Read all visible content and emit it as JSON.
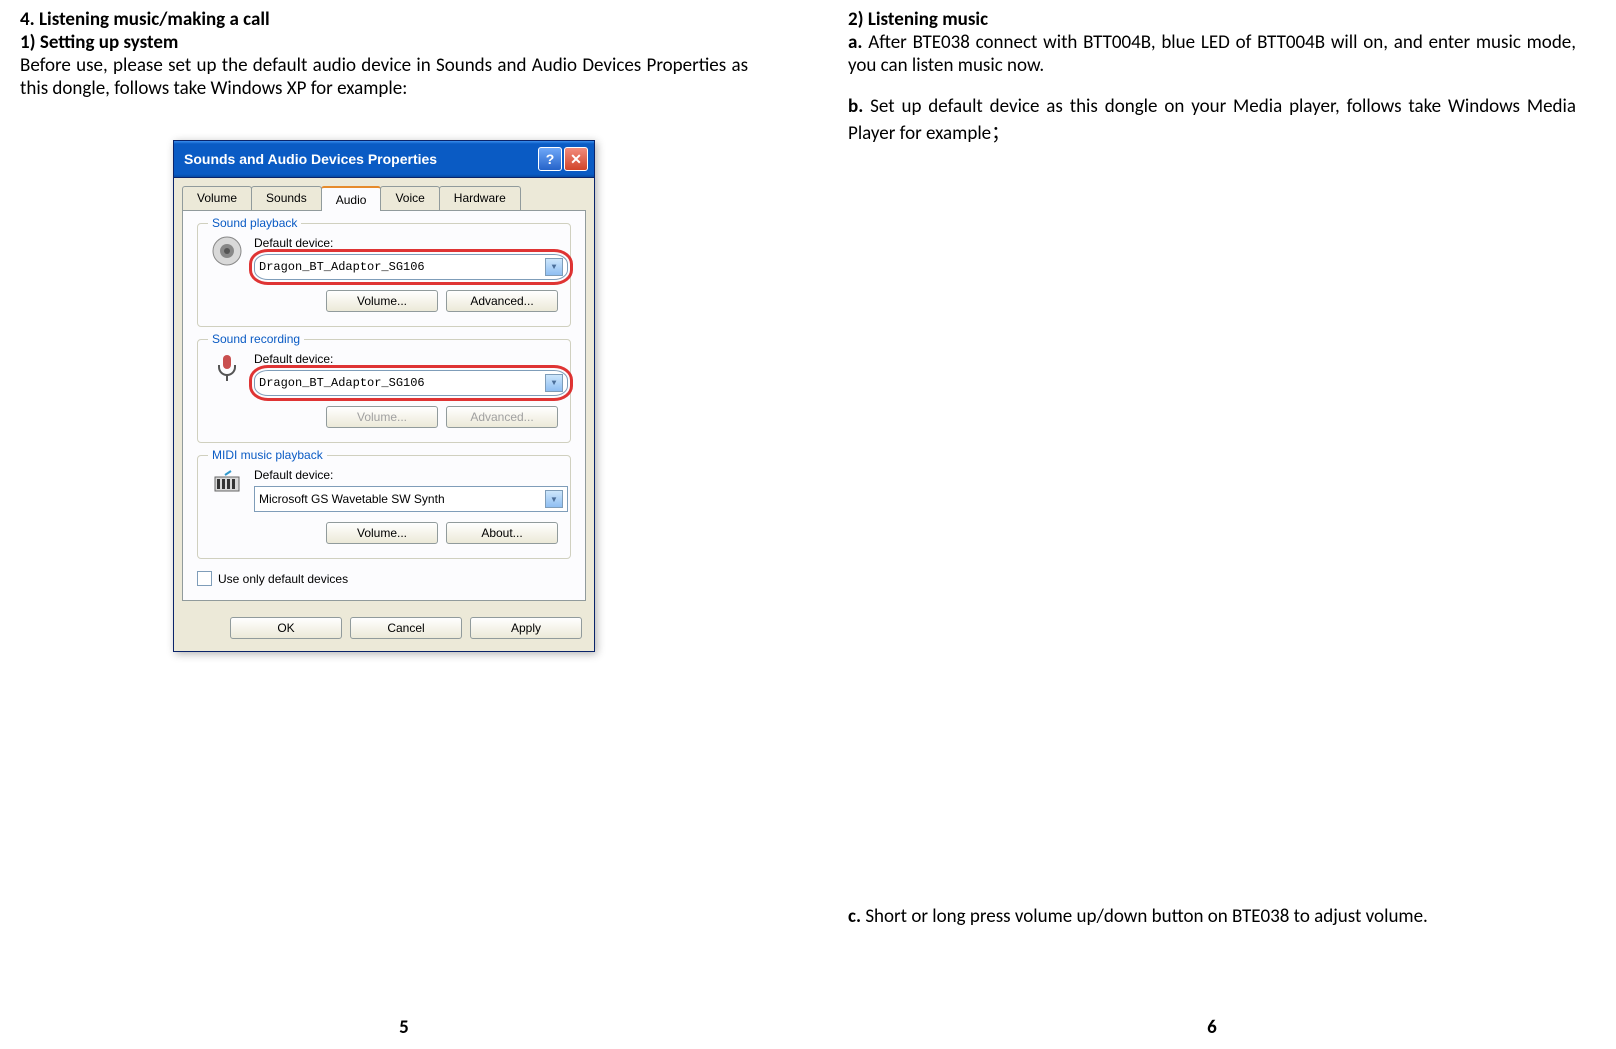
{
  "left": {
    "heading1": "4. Listening music/making a call",
    "heading2": "1) Setting up system",
    "para": "Before use, please set up the default audio device in Sounds and Audio Devices Properties as this dongle, follows take Windows XP for example:",
    "page_num": "5"
  },
  "right": {
    "heading": "2) Listening music",
    "a_prefix": "a.",
    "a_text": " After BTE038 connect with BTT004B, blue LED of BTT004B will on, and enter music mode, you can listen music now.",
    "b_prefix": "b.",
    "b_text": " Set up default device as this dongle on your Media player, follows take Windows Media Player for example；",
    "c_prefix": "c.",
    "c_text": " Short or long press volume up/down button on BTE038 to adjust volume.",
    "page_num": "6"
  },
  "dialog": {
    "title": "Sounds and Audio Devices Properties",
    "help_btn": "?",
    "close_btn": "✕",
    "tabs": [
      "Volume",
      "Sounds",
      "Audio",
      "Voice",
      "Hardware"
    ],
    "active_tab": "Audio",
    "playback": {
      "legend": "Sound playback",
      "label": "Default device:",
      "value": "Dragon_BT_Adaptor_SG106",
      "btn1": "Volume...",
      "btn2": "Advanced..."
    },
    "recording": {
      "legend": "Sound recording",
      "label": "Default device:",
      "value": "Dragon_BT_Adaptor_SG106",
      "btn1": "Volume...",
      "btn2": "Advanced..."
    },
    "midi": {
      "legend": "MIDI music playback",
      "label": "Default device:",
      "value": "Microsoft GS Wavetable SW Synth",
      "btn1": "Volume...",
      "btn2": "About..."
    },
    "checkbox_label": "Use only default devices",
    "ok": "OK",
    "cancel": "Cancel",
    "apply": "Apply"
  }
}
